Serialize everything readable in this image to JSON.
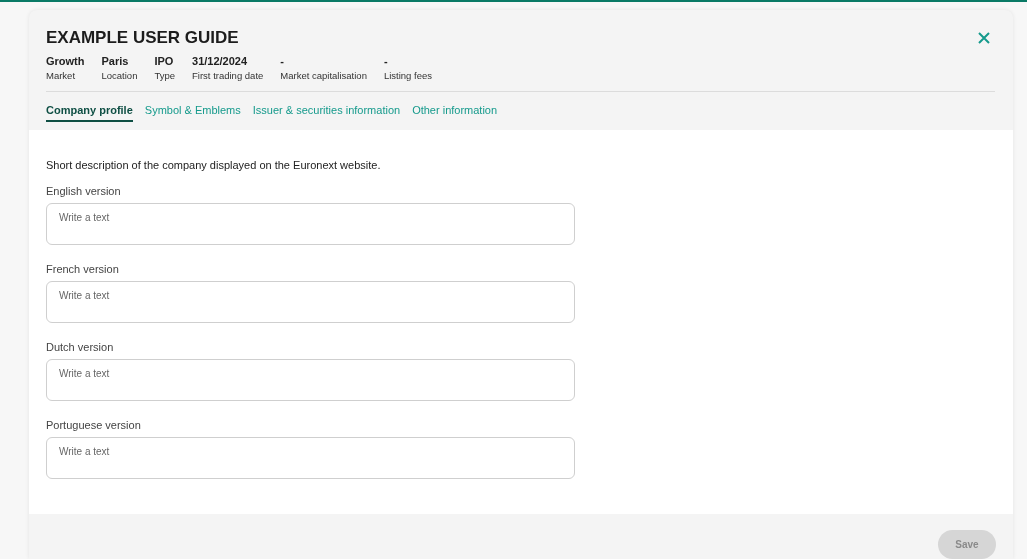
{
  "dialog": {
    "title": "EXAMPLE USER GUIDE"
  },
  "facts": [
    {
      "value": "Growth",
      "label": "Market"
    },
    {
      "value": "Paris",
      "label": "Location"
    },
    {
      "value": "IPO",
      "label": "Type"
    },
    {
      "value": "31/12/2024",
      "label": "First trading date"
    },
    {
      "value": "-",
      "label": "Market capitalisation"
    },
    {
      "value": "-",
      "label": "Listing fees"
    }
  ],
  "tabs": [
    {
      "label": "Company profile",
      "selected": true
    },
    {
      "label": "Symbol & Emblems",
      "selected": false
    },
    {
      "label": "Issuer & securities information",
      "selected": false
    },
    {
      "label": "Other information",
      "selected": false
    }
  ],
  "description": "Short description of the company displayed on the Euronext website.",
  "fields": [
    {
      "label": "English version",
      "placeholder": "Write a text"
    },
    {
      "label": "French version",
      "placeholder": "Write a text"
    },
    {
      "label": "Dutch version",
      "placeholder": "Write a text"
    },
    {
      "label": "Portuguese version",
      "placeholder": "Write a text"
    }
  ],
  "save_button": {
    "label": "Save",
    "disabled": true
  }
}
